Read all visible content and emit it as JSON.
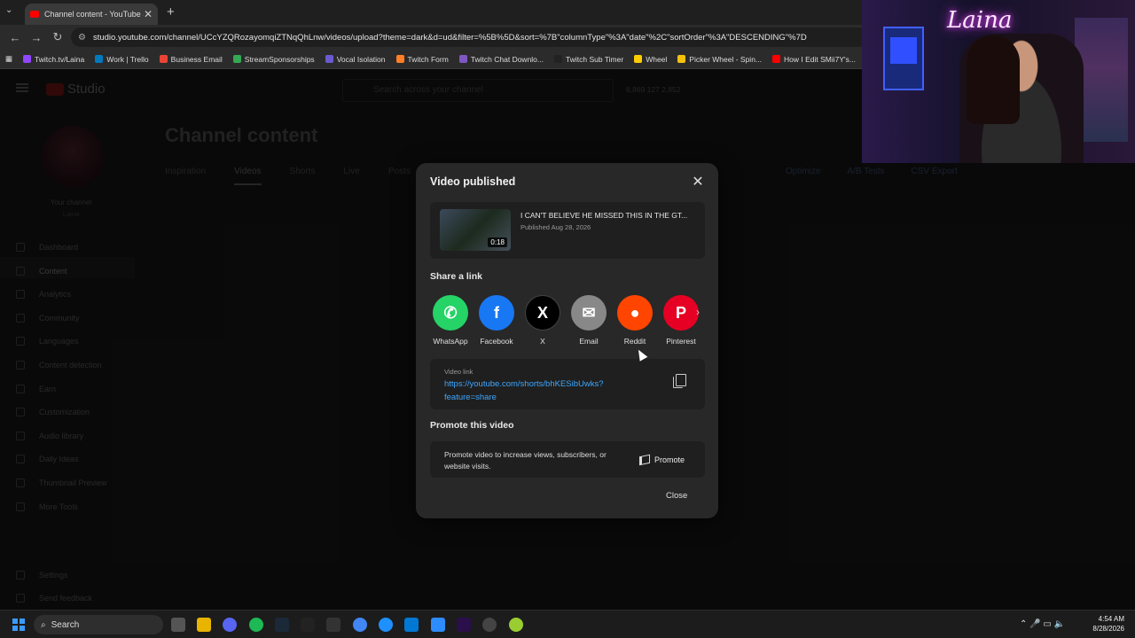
{
  "browser": {
    "tab_title": "Channel content - YouTube Stu",
    "tab_close": "✕",
    "new_tab": "+",
    "url": "studio.youtube.com/channel/UCcYZQRozayomqiZTNqQhLnw/videos/upload?theme=dark&d=ud&filter=%5B%5D&sort=%7B\"columnType\"%3A\"date\"%2C\"sortOrder\"%3A\"DESCENDING\"%7D",
    "bookmarks": [
      {
        "label": "Twitch.tv/Laina",
        "color": "#9146ff"
      },
      {
        "label": "Work | Trello",
        "color": "#0079bf"
      },
      {
        "label": "Business Email",
        "color": "#ea4335"
      },
      {
        "label": "StreamSponsorships",
        "color": "#34a853"
      },
      {
        "label": "Vocal Isolation",
        "color": "#6a5acd"
      },
      {
        "label": "Twitch Form",
        "color": "#ff7f27"
      },
      {
        "label": "Twitch Chat Downlo...",
        "color": "#7e57c2"
      },
      {
        "label": "Twitch Sub Timer",
        "color": "#222222"
      },
      {
        "label": "Wheel",
        "color": "#ffcc00"
      },
      {
        "label": "Picker Wheel - Spin...",
        "color": "#f4c20d"
      },
      {
        "label": "How I Edit SMii7Y's...",
        "color": "#ff0000"
      }
    ]
  },
  "studio": {
    "logo_text": "Studio",
    "search_placeholder": "Search across your channel",
    "stats": "6,869   127   2,852",
    "your_channel": "Your channel",
    "channel_name": "Laina",
    "page_title": "Channel content",
    "tabs": [
      "Inspiration",
      "Videos",
      "Shorts",
      "Live",
      "Posts"
    ],
    "right_tabs": [
      "Optimize",
      "A/B Tests",
      "CSV Export"
    ],
    "nav": [
      "Dashboard",
      "Content",
      "Analytics",
      "Community",
      "Languages",
      "Content detection",
      "Earn",
      "Customization",
      "Audio library",
      "Daily Ideas",
      "Thumbnail Preview",
      "More Tools"
    ],
    "settings": "Settings",
    "feedback": "Send feedback"
  },
  "dialog": {
    "title": "Video published",
    "video_title": "I CAN'T BELIEVE HE MISSED THIS IN THE GT...",
    "published": "Published Aug 28, 2026",
    "duration": "0:18",
    "share_heading": "Share a link",
    "share_targets": [
      {
        "label": "WhatsApp",
        "color": "#25d366",
        "glyph": "✆"
      },
      {
        "label": "Facebook",
        "color": "#1877f2",
        "glyph": "f"
      },
      {
        "label": "X",
        "color": "#000000",
        "glyph": "X"
      },
      {
        "label": "Email",
        "color": "#888888",
        "glyph": "✉"
      },
      {
        "label": "Reddit",
        "color": "#ff4500",
        "glyph": "●"
      },
      {
        "label": "Pinterest",
        "color": "#e60023",
        "glyph": "P"
      }
    ],
    "next_icon": "›",
    "link_label": "Video link",
    "link_url": "https://youtube.com/shorts/bhKESibUwks?feature=share",
    "promote_heading": "Promote this video",
    "promote_text": "Promote video to increase views, subscribers, or website visits.",
    "promote_button": "Promote",
    "close_button": "Close",
    "close_icon": "✕"
  },
  "webcam": {
    "neon_sign": "Laina"
  },
  "taskbar": {
    "search": "Search",
    "time": "4:54 AM",
    "date": "8/28/2026"
  }
}
